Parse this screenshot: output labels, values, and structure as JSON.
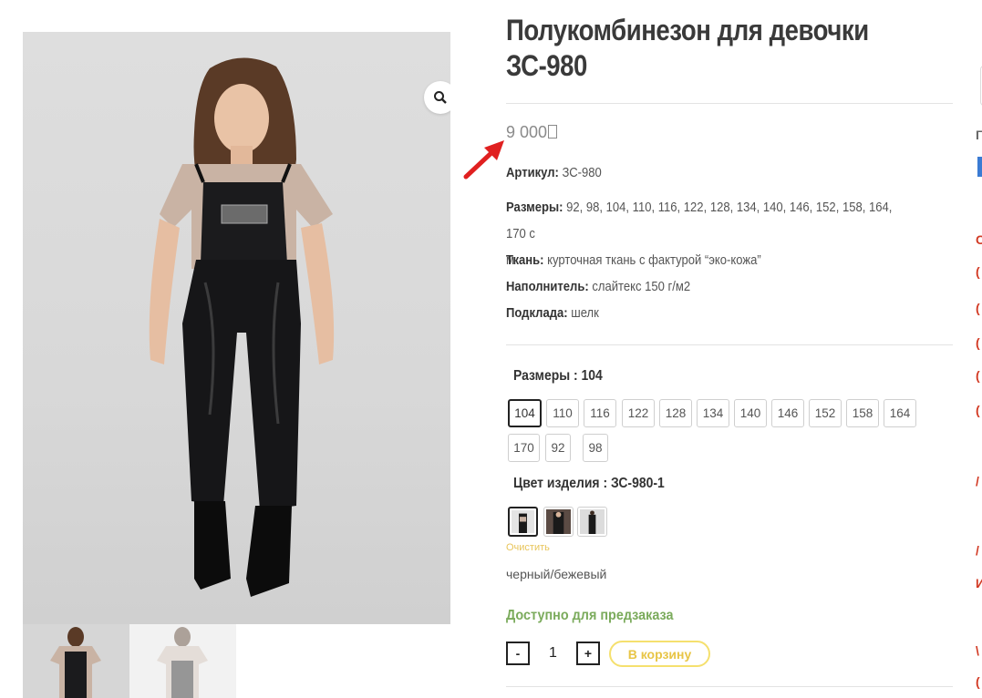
{
  "product": {
    "title_line1": "Полукомбинезон для девочки",
    "title_line2": "ЗС-980",
    "price": "9 000",
    "currency_glyph": "missing-glyph-box"
  },
  "specs": {
    "article_label": "Артикул:",
    "article_value": "ЗС-980",
    "sizes_label": "Размеры:",
    "sizes_value_line1": "92, 98, 104, 110, 116, 122, 128, 134, 140, 146, 152, 158, 164, 170 с",
    "sizes_value_line2": "м",
    "fabric_label": "Ткань:",
    "fabric_value": "курточная ткань с фактурой “эко-кожа”",
    "filler_label": "Наполнитель:",
    "filler_value": "слайтекс 150 г/м2",
    "lining_label": "Подклада:",
    "lining_value": "шелк"
  },
  "variations": {
    "size_label": "Размеры : 104",
    "sizes": [
      "104",
      "110",
      "116",
      "122",
      "128",
      "134",
      "140",
      "146",
      "152",
      "158",
      "164",
      "170",
      "92",
      "98"
    ],
    "selected_size": "104",
    "color_label": "Цвет изделия : ЗС-980-1",
    "swatches": [
      "black-beige-front",
      "black-beige-back",
      "black-full"
    ],
    "clear_label": "Очистить",
    "color_value": "черный/бежевый"
  },
  "stock": {
    "availability": "Доступно для предзаказа"
  },
  "cart": {
    "minus_label": "-",
    "quantity": "1",
    "plus_label": "+",
    "add_to_cart_label": "В корзину"
  },
  "sidebar": {
    "marks": [
      "Г",
      "С",
      "(",
      "(",
      "(",
      "(",
      "(",
      "/",
      "/",
      "И",
      "\\",
      "("
    ]
  },
  "colors": {
    "accent_yellow": "#f5e06e",
    "availability_green": "#7bab5c",
    "arrow_red": "#e02020"
  }
}
